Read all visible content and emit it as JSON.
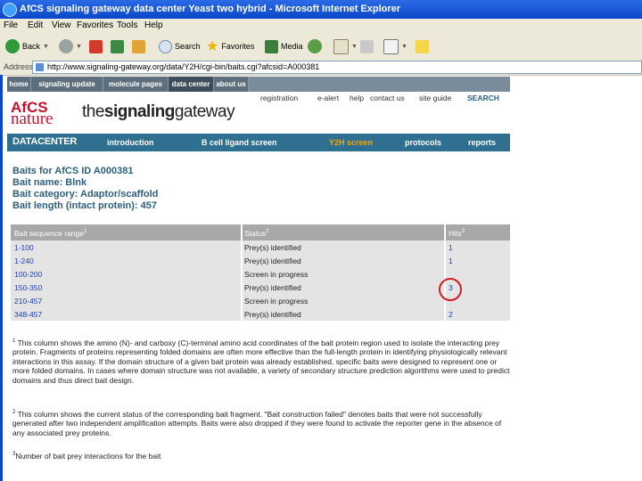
{
  "window": {
    "title": "AfCS signaling gateway   data center   Yeast two hybrid - Microsoft Internet Explorer"
  },
  "menu": [
    "File",
    "Edit",
    "View",
    "Favorites",
    "Tools",
    "Help"
  ],
  "toolbar": {
    "back": "Back",
    "search": "Search",
    "favorites": "Favorites",
    "media": "Media"
  },
  "address": {
    "label": "Address",
    "url": "http://www.signaling-gateway.org/data/Y2H/cgi-bin/baits.cgi?afcsid=A000381"
  },
  "site_nav": [
    "home",
    "signaling update",
    "molecule pages",
    "data center",
    "about us"
  ],
  "util_links": [
    "registration",
    "e-alert",
    "help",
    "contact us",
    "site guide",
    "SEARCH"
  ],
  "brand": {
    "afcs": "AfCS",
    "nature": "nature",
    "the": "the",
    "signaling": "signaling",
    "gateway": "gateway"
  },
  "data_nav": {
    "title": "DATACENTER",
    "items": [
      "introduction",
      "B cell ligand screen",
      "Y2H screen",
      "protocols",
      "reports"
    ]
  },
  "bait_info": [
    "Baits for AfCS ID A000381",
    "Bait name: Blnk",
    "Bait category: Adaptor/scaffold",
    "Bait length (intact protein): 457"
  ],
  "table": {
    "headers": [
      "Bait sequence range",
      "Status",
      "Hits"
    ],
    "header_sups": [
      "1",
      "2",
      "3"
    ],
    "rows": [
      {
        "range": "1-100",
        "status": "Prey(s) identified",
        "hits": "1"
      },
      {
        "range": "1-240",
        "status": "Prey(s) identified",
        "hits": "1"
      },
      {
        "range": "100-200",
        "status": "Screen in progress",
        "hits": ""
      },
      {
        "range": "150-350",
        "status": "Prey(s) identified",
        "hits": "3"
      },
      {
        "range": "210-457",
        "status": "Screen in progress",
        "hits": ""
      },
      {
        "range": "348-457",
        "status": "Prey(s) identified",
        "hits": "2"
      }
    ]
  },
  "footnotes": [
    {
      "num": "1",
      "text": "This column shows the amino (N)- and carboxy (C)-terminal amino acid coordinates of the bait protein region used to isolate the interacting prey protein. Fragments of proteins representing folded domains are often more effective than the full-length protein in identifying physiologically relevant interactions in this assay. If the domain structure of a given bait protein was already established, specific baits were designed to represent one or more folded domains. In cases where domain structure was not available, a variety of secondary structure prediction algorithms were used to predict domains and thus direct bait design."
    },
    {
      "num": "2",
      "text": "This column shows the current status of the corresponding bait fragment. \"Bait construction failed\" denotes baits that were not successfully generated after two independent amplification attempts. Baits were also dropped if they were found to activate the reporter gene in the absence of any associated prey proteins."
    },
    {
      "num": "3",
      "text": "Number of bait prey interactions for the bait"
    }
  ],
  "colors": {
    "titlebar": "#0a47c9",
    "heading": "#2c5f7f",
    "link": "#1a3dbf",
    "highlight_circle": "#d21f1f",
    "active_nav": "#f7a600"
  }
}
